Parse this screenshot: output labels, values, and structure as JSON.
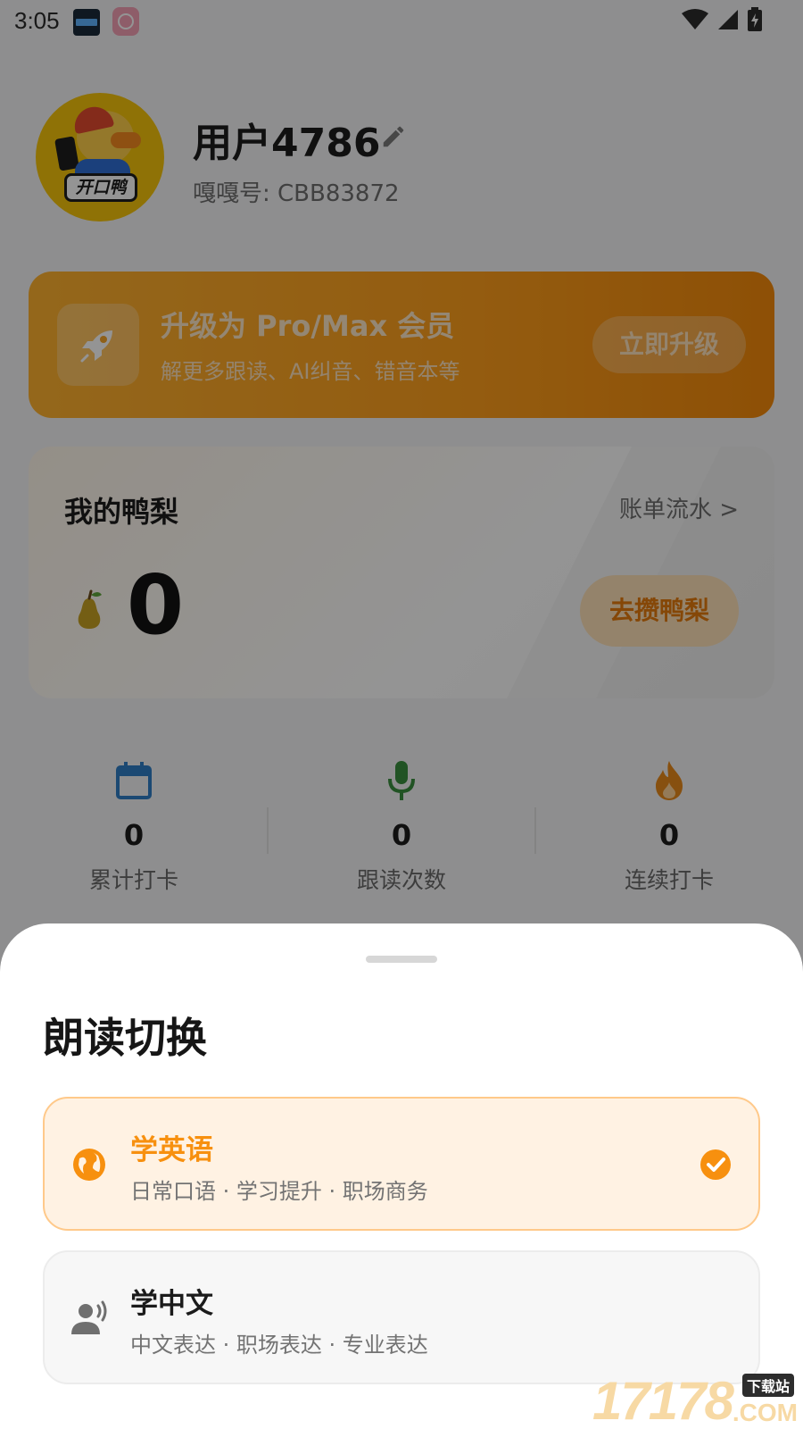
{
  "status_bar": {
    "time": "3:05",
    "icons": [
      "notification-app-icon",
      "notification-app-icon-2",
      "wifi-icon",
      "signal-icon",
      "battery-icon"
    ]
  },
  "profile": {
    "username": "用户4786",
    "id_text": "嘎嘎号: CBB83872",
    "avatar_badge": "开口鸭"
  },
  "vip": {
    "title": "升级为 Pro/Max 会员",
    "subtitle": "解更多跟读、AI纠音、错音本等",
    "button": "立即升级",
    "icon": "rocket-icon"
  },
  "wallet": {
    "title": "我的鸭梨",
    "link": "账单流水 >",
    "balance": "0",
    "button": "去攒鸭梨",
    "icon": "pear-icon"
  },
  "stats": [
    {
      "value": "0",
      "label": "累计打卡",
      "icon": "calendar-icon",
      "color": "#2f7fc6"
    },
    {
      "value": "0",
      "label": "跟读次数",
      "icon": "microphone-icon",
      "color": "#3a8f3e"
    },
    {
      "value": "0",
      "label": "连续打卡",
      "icon": "fire-icon",
      "color": "#e98a1b"
    }
  ],
  "sheet": {
    "title": "朗读切换",
    "options": [
      {
        "title": "学英语",
        "subtitle": "日常口语 · 学习提升 · 职场商务",
        "icon": "globe-icon",
        "selected": true
      },
      {
        "title": "学中文",
        "subtitle": "中文表达 · 职场表达 · 专业表达",
        "icon": "speaking-person-icon",
        "selected": false
      }
    ]
  },
  "watermark": {
    "number": "17178",
    "tag": "下载站",
    "suffix": ".COM"
  },
  "colors": {
    "accent": "#f7900f",
    "overlay": "rgba(0,0,0,0.42)"
  }
}
